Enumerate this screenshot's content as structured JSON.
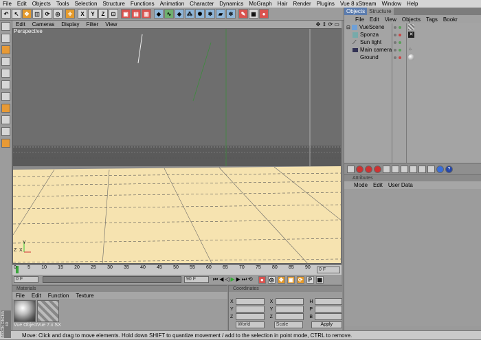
{
  "menubar": [
    "File",
    "Edit",
    "Objects",
    "Tools",
    "Selection",
    "Structure",
    "Functions",
    "Animation",
    "Character",
    "Dynamics",
    "MoGraph",
    "Hair",
    "Render",
    "Plugins",
    "Vue 8 xStream",
    "Window",
    "Help"
  ],
  "viewport": {
    "menu": [
      "Edit",
      "Cameras",
      "Display",
      "Filter",
      "View"
    ],
    "label": "Perspective",
    "axis_z": "Z",
    "axis_x": "X",
    "axis_y": "Y"
  },
  "timeline": {
    "ticks": [
      "0",
      "5",
      "10",
      "15",
      "20",
      "25",
      "30",
      "35",
      "40",
      "45",
      "50",
      "55",
      "60",
      "65",
      "70",
      "75",
      "80",
      "85",
      "90"
    ],
    "current_frame": "0 F"
  },
  "transport": {
    "start": "0 F",
    "end": "90 F"
  },
  "materials": {
    "title": "Materials",
    "menu": [
      "File",
      "Edit",
      "Function",
      "Texture"
    ],
    "items": [
      "Vue Object",
      "Vue 7.x SX"
    ]
  },
  "coordinates": {
    "title": "Coordinates",
    "labels_left": [
      "X",
      "Y",
      "Z"
    ],
    "labels_mid": [
      "X",
      "Y",
      "Z"
    ],
    "labels_right": [
      "H",
      "P",
      "B"
    ],
    "mode_select": "World",
    "scale_select": "Scale",
    "apply": "Apply"
  },
  "objects_panel": {
    "tabs": [
      "Objects",
      "Structure"
    ],
    "menu": [
      "File",
      "Edit",
      "View",
      "Objects",
      "Tags",
      "Bookr"
    ],
    "items": [
      "VueScene",
      "Sponza",
      "Sun light",
      "Main camera",
      "Ground"
    ]
  },
  "attributes_panel": {
    "title": "Attributes",
    "menu": [
      "Mode",
      "Edit",
      "User Data"
    ]
  },
  "status": "Move: Click and drag to move elements. Hold down SHIFT to quantize movement / add to the selection in point mode, CTRL to remove.",
  "logo": "MAXON CINEMA 4D",
  "colors": {
    "floor": "#f6e3b0",
    "sky": "#6e6e6e",
    "tab_active": "#5b7cae"
  }
}
